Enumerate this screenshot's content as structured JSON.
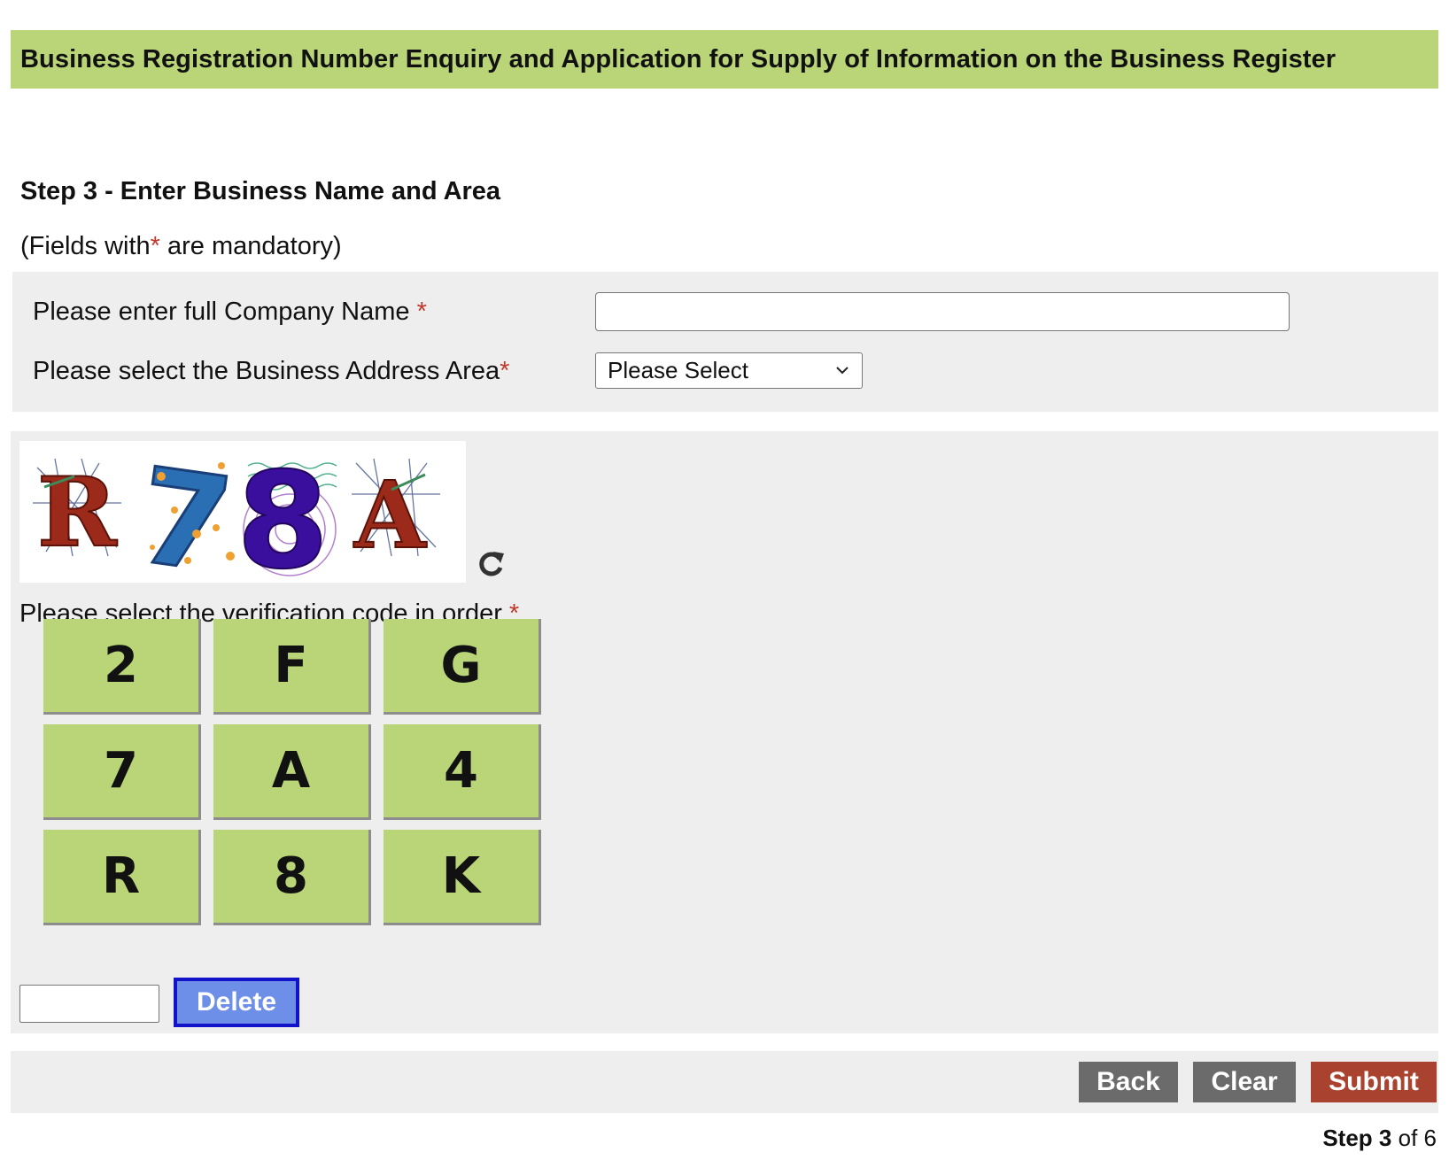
{
  "header": {
    "title": "Business Registration Number Enquiry and Application for Supply of Information on the Business Register"
  },
  "step": {
    "title": "Step 3 - Enter Business Name and Area"
  },
  "note": {
    "prefix": "(Fields with",
    "star": "*",
    "suffix": " are mandatory)"
  },
  "form": {
    "company_label": "Please enter full Company Name",
    "company_star": "*",
    "company_value": "",
    "area_label": "Please select the Business Address Area",
    "area_star": "*",
    "area_selected": "Please Select"
  },
  "captcha": {
    "image_text": "R78A",
    "refresh_icon": "refresh-icon",
    "label": "Please select the verification code in order",
    "star": "*",
    "keys": [
      "2",
      "F",
      "G",
      "7",
      "A",
      "4",
      "R",
      "8",
      "K"
    ],
    "input_value": "",
    "delete_label": "Delete"
  },
  "actions": {
    "back": "Back",
    "clear": "Clear",
    "submit": "Submit"
  },
  "progress": {
    "prefix": "Step",
    "current": "3",
    "suffix": "of 6"
  },
  "colors": {
    "header_bg": "#b9d577",
    "panel_bg": "#eeeeee",
    "required": "#c0392b",
    "gray_button": "#6b6b6b",
    "submit_button": "#a9432f",
    "delete_button": "#6e8fe8",
    "delete_border": "#1212c8"
  }
}
